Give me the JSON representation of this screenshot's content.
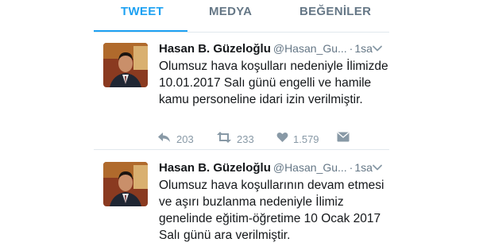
{
  "tabs": [
    {
      "label": "TWEET",
      "active": true
    },
    {
      "label": "MEDYA",
      "active": false
    },
    {
      "label": "BEĞENİLER",
      "active": false
    }
  ],
  "accent_color": "#1da1f2",
  "tweets": [
    {
      "name": "Hasan B. Güzeloğlu",
      "handle": "@Hasan_Gu...",
      "separator": "·",
      "time": "1sa",
      "text": "Olumsuz hava koşulları nedeniyle İlimizde 10.01.2017 Salı günü engelli ve hamile kamu personeline idari izin verilmiştir.",
      "replies": "203",
      "retweets": "233",
      "likes": "1.579"
    },
    {
      "name": "Hasan B. Güzeloğlu",
      "handle": "@Hasan_Gu...",
      "separator": "·",
      "time": "1sa",
      "text": "Olumsuz hava koşullarının devam etmesi ve aşırı buzlanma nedeniyle İlimiz genelinde eğitim-öğretime 10 Ocak 2017 Salı günü ara verilmiştir."
    }
  ],
  "icons": {
    "reply": "reply-icon",
    "retweet": "retweet-icon",
    "like": "heart-icon",
    "dm": "direct-message-icon",
    "caret": "chevron-down-icon"
  }
}
